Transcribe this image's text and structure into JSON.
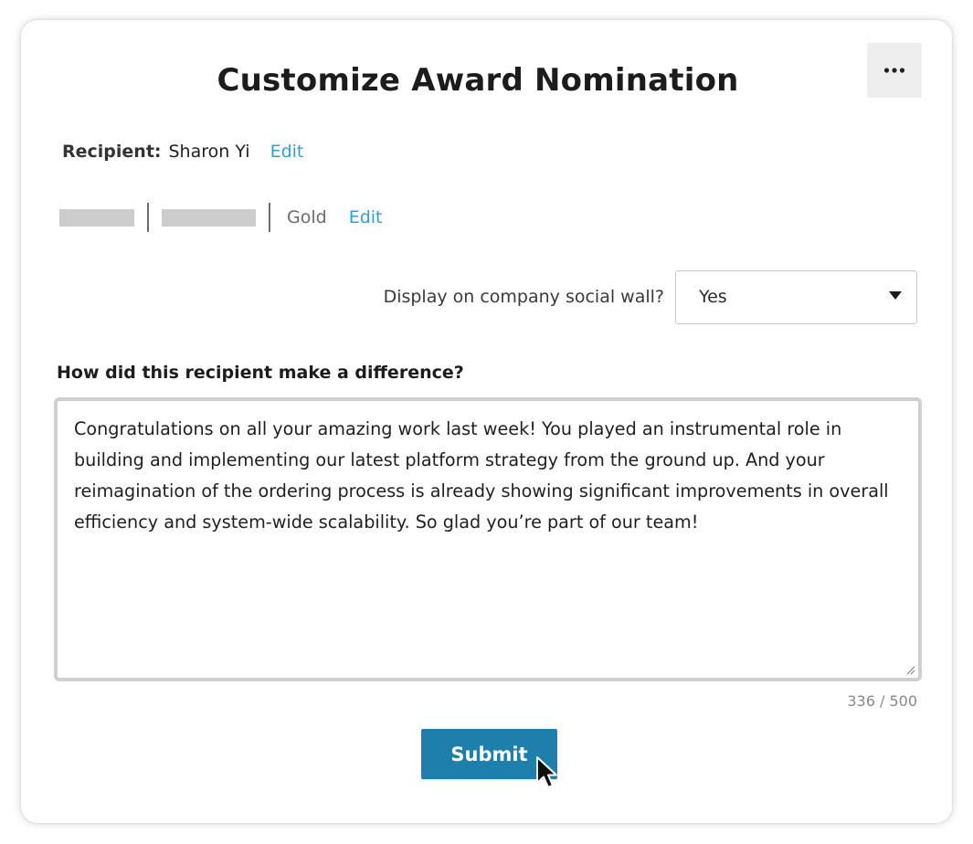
{
  "dialog": {
    "title": "Customize Award Nomination",
    "more_icon": "ellipsis-icon"
  },
  "recipient": {
    "label": "Recipient:",
    "name": "Sharon Yi",
    "edit_label": "Edit"
  },
  "award": {
    "level": "Gold",
    "edit_label": "Edit"
  },
  "social_wall": {
    "label": "Display on company social wall?",
    "selected": "Yes",
    "caret_icon": "caret-down-icon"
  },
  "message": {
    "question": "How did this recipient make a difference?",
    "text": "Congratulations on all your amazing work last week! You played an instrumental role in building and implementing our latest platform strategy from the ground up. And your reimagination of the ordering process is already showing significant improvements in overall efficiency and system-wide scalability. So glad you’re part of our team!",
    "char_count": "336 / 500"
  },
  "actions": {
    "submit_label": "Submit"
  },
  "colors": {
    "link": "#2f9fd4",
    "primary_button": "#1f7fac",
    "more_button_bg": "#eeeeee"
  }
}
